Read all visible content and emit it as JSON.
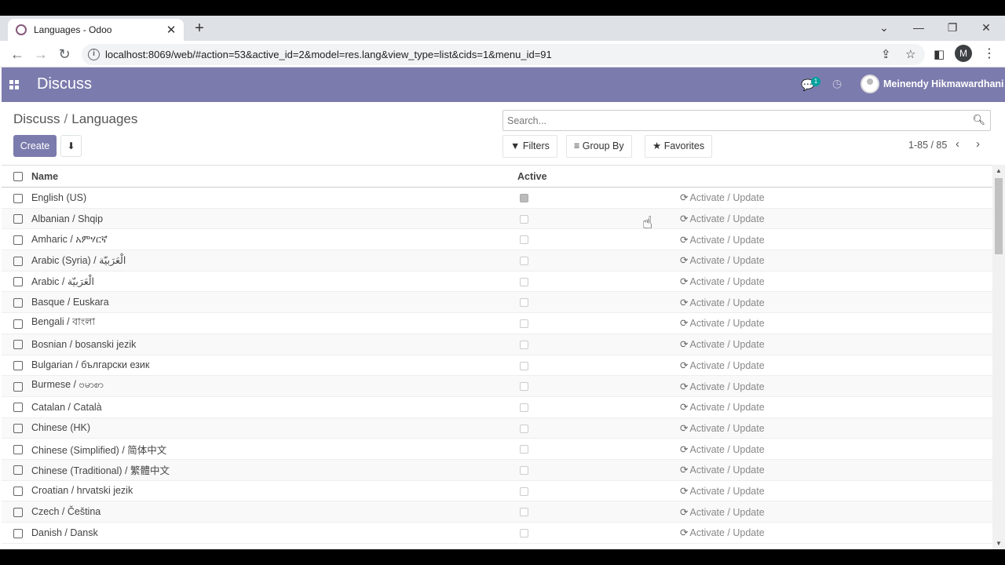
{
  "browser": {
    "tab_title": "Languages - Odoo",
    "url": "localhost:8069/web/#action=53&active_id=2&model=res.lang&view_type=list&cids=1&menu_id=91",
    "profile_initial": "M"
  },
  "navbar": {
    "app_name": "Discuss",
    "chat_count": "1",
    "user_name": "Meinendy Hikmawardhani",
    "color": "#7c7bad"
  },
  "control_panel": {
    "breadcrumb_parent": "Discuss",
    "breadcrumb_current": "Languages",
    "create_label": "Create",
    "search_placeholder": "Search...",
    "filters_label": "Filters",
    "groupby_label": "Group By",
    "favorites_label": "Favorites",
    "pager": "1-85 / 85"
  },
  "table": {
    "headers": {
      "name": "Name",
      "active": "Active"
    },
    "action_label": "Activate / Update",
    "rows": [
      {
        "name": "English (US)",
        "active": true
      },
      {
        "name": "Albanian / Shqip",
        "active": false
      },
      {
        "name": "Amharic / አምሃርኛ",
        "active": false
      },
      {
        "name": "Arabic (Syria) / الْعَرَبيّة",
        "active": false
      },
      {
        "name": "Arabic / الْعَرَبيّة",
        "active": false
      },
      {
        "name": "Basque / Euskara",
        "active": false
      },
      {
        "name": "Bengali / বাংলা",
        "active": false
      },
      {
        "name": "Bosnian / bosanski jezik",
        "active": false
      },
      {
        "name": "Bulgarian / български език",
        "active": false
      },
      {
        "name": "Burmese / ဗမာစာ",
        "active": false
      },
      {
        "name": "Catalan / Català",
        "active": false
      },
      {
        "name": "Chinese (HK)",
        "active": false
      },
      {
        "name": "Chinese (Simplified) / 简体中文",
        "active": false
      },
      {
        "name": "Chinese (Traditional) / 繁體中文",
        "active": false
      },
      {
        "name": "Croatian / hrvatski jezik",
        "active": false
      },
      {
        "name": "Czech / Čeština",
        "active": false
      },
      {
        "name": "Danish / Dansk",
        "active": false
      }
    ]
  }
}
